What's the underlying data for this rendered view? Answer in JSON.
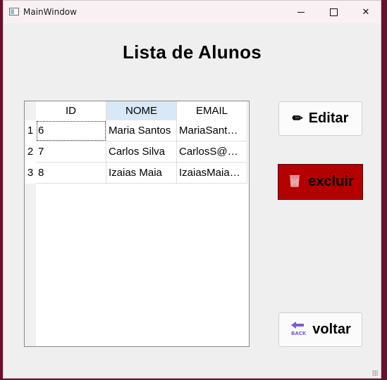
{
  "window": {
    "title": "MainWindow"
  },
  "heading": "Lista de Alunos",
  "table": {
    "columns": [
      "ID",
      "NOME",
      "EMAIL"
    ],
    "row_numbers": [
      "1",
      "2",
      "3"
    ],
    "rows": [
      [
        "6",
        "Maria Santos",
        "MariaSant…"
      ],
      [
        "7",
        "Carlos Silva",
        "CarlosS@…"
      ],
      [
        "8",
        "Izaias Maia",
        "IzaiasMaia…"
      ]
    ]
  },
  "buttons": {
    "edit": "Editar",
    "delete": "excluir",
    "back": "voltar"
  },
  "icons": {
    "edit": "pencil-icon",
    "delete": "trash-icon",
    "back": "back-arrow-icon"
  },
  "colors": {
    "delete_button": "#b50000",
    "selected_header": "#d9e8f6"
  }
}
